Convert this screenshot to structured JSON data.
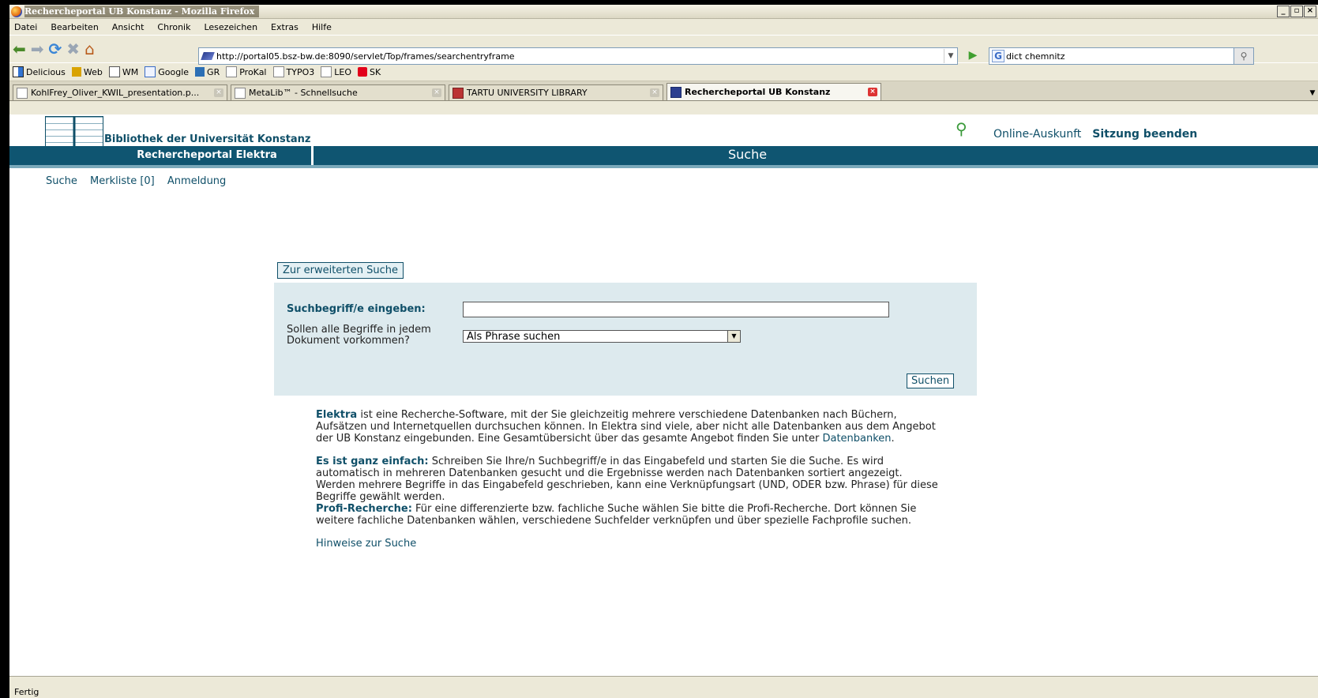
{
  "window": {
    "title": "Rechercheportal UB Konstanz - Mozilla Firefox"
  },
  "menu": [
    "Datei",
    "Bearbeiten",
    "Ansicht",
    "Chronik",
    "Lesezeichen",
    "Extras",
    "Hilfe"
  ],
  "nav": {
    "url": "http://portal05.bsz-bw.de:8090/servlet/Top/frames/searchentryframe",
    "search_value": "dict chemnitz"
  },
  "bookmarks": [
    "Delicious",
    "Web",
    "WM",
    "Google",
    "GR",
    "ProKal",
    "TYPO3",
    "LEO",
    "SK"
  ],
  "tabs": [
    {
      "label": "KohlFrey_Oliver_KWIL_presentation.p..."
    },
    {
      "label": "MetaLib™ - Schnellsuche"
    },
    {
      "label": "TARTU UNIVERSITY LIBRARY"
    },
    {
      "label": "Rechercheportal UB Konstanz"
    }
  ],
  "header": {
    "library": "Bibliothek der Universität Konstanz",
    "portal": "Rechercheportal Elektra",
    "section": "Suche",
    "online_help": "Online-Auskunft",
    "end_session": "Sitzung beenden"
  },
  "subnav": {
    "search": "Suche",
    "watchlist": "Merkliste [0]",
    "login": "Anmeldung"
  },
  "form": {
    "advanced": "Zur erweiterten Suche",
    "term_label": "Suchbegriff/e eingeben:",
    "term_value": "",
    "mode_label": "Sollen alle Begriffe in jedem Dokument vorkommen?",
    "mode_value": "Als Phrase suchen",
    "submit": "Suchen"
  },
  "info": {
    "p1_key": "Elektra",
    "p1_text": " ist eine Recherche-Software, mit der Sie gleichzeitig mehrere verschiedene Datenbanken nach Büchern, Aufsätzen und Internetquellen durchsuchen können. In Elektra sind viele, aber nicht alle Datenbanken aus dem Angebot der UB Konstanz eingebunden. Eine Gesamtübersicht über das gesamte Angebot finden Sie unter ",
    "p1_link": "Datenbanken",
    "p1_end": ".",
    "p2_key": "Es ist ganz einfach:",
    "p2_text": " Schreiben Sie Ihre/n Suchbegriff/e in das Eingabefeld und starten Sie die Suche. Es wird automatisch in mehreren Datenbanken gesucht und die Ergebnisse werden nach Datenbanken sortiert angezeigt. Werden mehrere Begriffe in das Eingabefeld geschrieben, kann eine Verknüpfungsart (UND, ODER bzw. Phrase) für diese Begriffe gewählt werden.",
    "p3_key": "Profi-Recherche:",
    "p3_text": " Für eine differenzierte bzw. fachliche Suche wählen Sie bitte die Profi-Recherche. Dort können Sie weitere fachliche Datenbanken wählen, verschiedene Suchfelder verknüpfen und über spezielle Fachprofile suchen.",
    "hints": "Hinweise zur Suche"
  },
  "status": "Fertig"
}
